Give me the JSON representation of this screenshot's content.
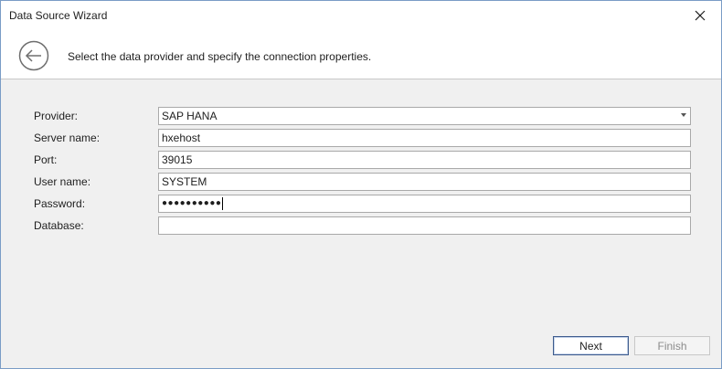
{
  "window": {
    "title": "Data Source Wizard",
    "close_icon": "close-icon"
  },
  "header": {
    "back_icon": "back-arrow-icon",
    "instruction": "Select the data provider and specify the connection properties."
  },
  "form": {
    "provider": {
      "label": "Provider:",
      "value": "SAP HANA"
    },
    "server_name": {
      "label": "Server name:",
      "value": "hxehost"
    },
    "port": {
      "label": "Port:",
      "value": "39015"
    },
    "user_name": {
      "label": "User name:",
      "value": "SYSTEM"
    },
    "password": {
      "label": "Password:",
      "value": "●●●●●●●●●●"
    },
    "database": {
      "label": "Database:",
      "value": ""
    }
  },
  "buttons": {
    "next_label": "Next",
    "finish_label": "Finish"
  },
  "colors": {
    "accent_border": "#3c5a8c",
    "window_border": "#7a9cc6"
  }
}
